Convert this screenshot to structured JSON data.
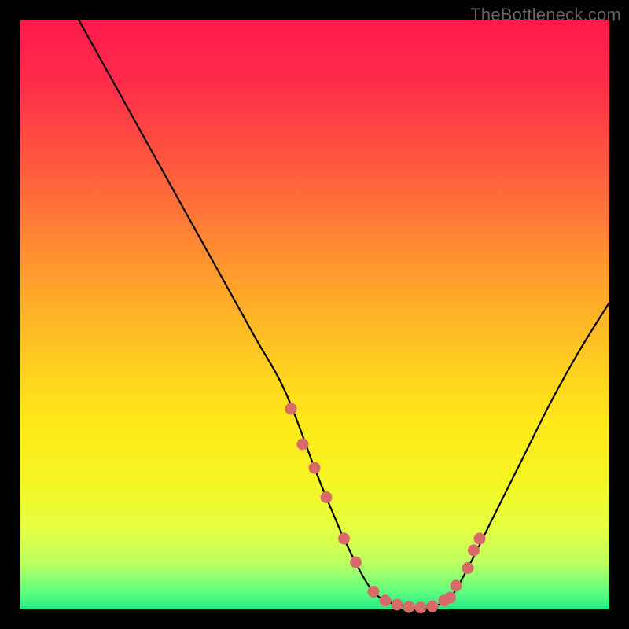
{
  "watermark": "TheBottleneck.com",
  "chart_data": {
    "type": "line",
    "title": "",
    "xlabel": "",
    "ylabel": "",
    "xlim": [
      0,
      100
    ],
    "ylim": [
      0,
      100
    ],
    "series": [
      {
        "name": "bottleneck-curve",
        "x": [
          10,
          15,
          20,
          25,
          30,
          35,
          40,
          45,
          50,
          52,
          55,
          58,
          60,
          62,
          65,
          68,
          70,
          73,
          76,
          80,
          85,
          90,
          95,
          100
        ],
        "y": [
          100,
          91,
          82,
          73,
          64,
          55,
          46,
          37,
          24,
          19,
          12,
          6,
          3,
          1.5,
          0.5,
          0.3,
          0.5,
          2,
          7,
          15,
          25,
          35,
          44,
          52
        ]
      }
    ],
    "marker_points": {
      "name": "highlight-dots",
      "x": [
        46,
        48,
        50,
        52,
        55,
        57,
        60,
        62,
        64,
        66,
        68,
        70,
        72,
        73,
        74,
        76,
        77,
        78
      ],
      "y": [
        34,
        28,
        24,
        19,
        12,
        8,
        3,
        1.5,
        0.8,
        0.4,
        0.3,
        0.5,
        1.5,
        2,
        4,
        7,
        10,
        12
      ]
    }
  }
}
